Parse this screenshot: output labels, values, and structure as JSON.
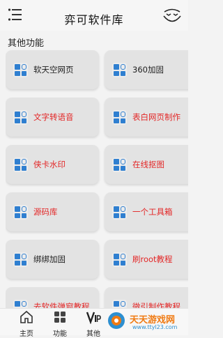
{
  "header": {
    "title": "弈可软件库",
    "menu_icon": "hamburger-icon",
    "face_icon": "face-icon"
  },
  "section": {
    "title": "其他功能"
  },
  "tools": [
    {
      "label": "软天空网页",
      "color": "dark"
    },
    {
      "label": "360加固",
      "color": "dark"
    },
    {
      "label": "文字转语音",
      "color": "red"
    },
    {
      "label": "表白网页制作",
      "color": "red"
    },
    {
      "label": "侠卡水印",
      "color": "red"
    },
    {
      "label": "在线抠图",
      "color": "red"
    },
    {
      "label": "源码库",
      "color": "red"
    },
    {
      "label": "一个工具箱",
      "color": "red"
    },
    {
      "label": "绑绑加固",
      "color": "dark"
    },
    {
      "label": "刷root教程",
      "color": "red"
    },
    {
      "label": "去软件弹窗教程",
      "color": "red"
    },
    {
      "label": "微引制作教程",
      "color": "red"
    }
  ],
  "colors": {
    "accent_blue": "#2f7fd0",
    "label_red": "#e32626",
    "card_bg": "#e3e3e3"
  },
  "bottom_nav": {
    "items": [
      {
        "label": "主页",
        "icon": "home-icon"
      },
      {
        "label": "功能",
        "icon": "grid-icon"
      },
      {
        "label": "其他",
        "icon": "vip-icon"
      }
    ]
  },
  "watermark": {
    "text": "天天游戏网",
    "url": "www.ttyl23.com"
  }
}
